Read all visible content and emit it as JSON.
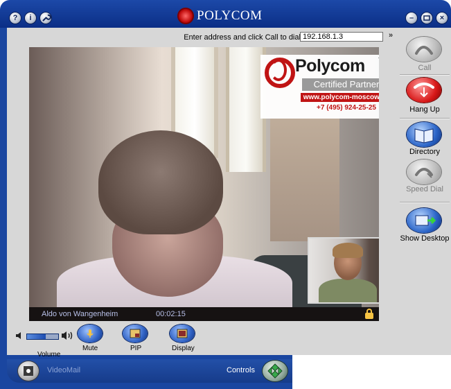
{
  "titlebar": {
    "brand": "POLYCOM",
    "help_button": "?",
    "info_button": "i",
    "minimize_button": "–",
    "close_button": "×"
  },
  "dial": {
    "prompt": "Enter address and click Call to dial:",
    "address_value": "192.168.1.3",
    "expand_label": "»"
  },
  "video": {
    "caller_name": "Aldo von Wangenheim",
    "call_duration": "00:02:15"
  },
  "badge": {
    "brand": "Polycom",
    "tm": "TM",
    "certified": "Certified Partner",
    "url": "www.polycom-moscow.ru",
    "phone": "+7 (495) 924-25-25"
  },
  "controls": {
    "volume_label": "Volume",
    "volume_level": 0.6,
    "mute_label": "Mute",
    "pip_label": "PIP",
    "display_label": "Display"
  },
  "sidebar": {
    "call_label": "Call",
    "hangup_label": "Hang Up",
    "directory_label": "Directory",
    "speed_dial_label": "Speed Dial",
    "show_desktop_label": "Show Desktop"
  },
  "bottom": {
    "videomail_label": "VideoMail",
    "controls_label": "Controls"
  },
  "colors": {
    "frame_blue": "#1a46a0",
    "panel_gray": "#d7d7d7",
    "hangup_red": "#d81818",
    "brand_red": "#c01414"
  }
}
